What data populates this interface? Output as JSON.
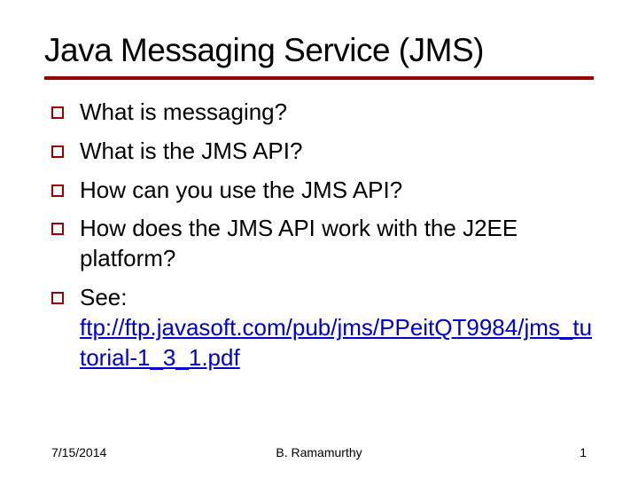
{
  "title": "Java Messaging Service (JMS)",
  "bullets": [
    {
      "text": "What is messaging?"
    },
    {
      "text": "What is the JMS API?"
    },
    {
      "text": "How can you use the JMS API?"
    },
    {
      "text": "How does the JMS API work with the J2EE platform?"
    },
    {
      "text": "See:",
      "link": "ftp://ftp.javasoft.com/pub/jms/PPeitQT9984/jms_tutorial-1_3_1.pdf"
    }
  ],
  "footer": {
    "date": "7/15/2014",
    "author": "B. Ramamurthy",
    "page": "1"
  }
}
